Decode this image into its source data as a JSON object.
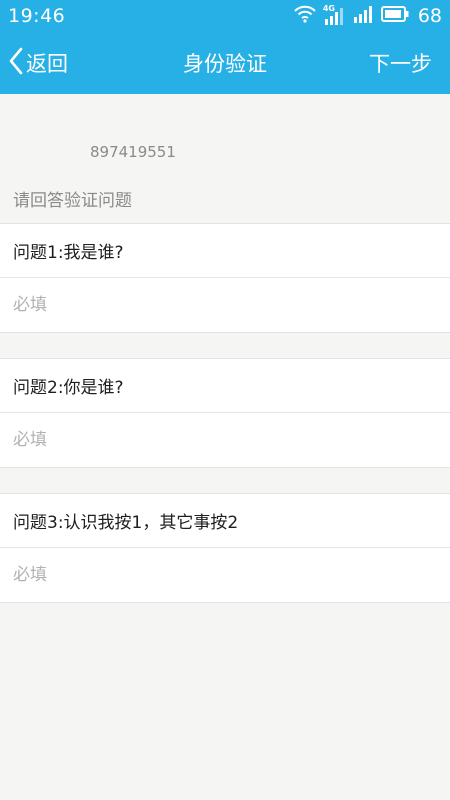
{
  "status_bar": {
    "time": "19:46",
    "network_label": "4G",
    "battery": "68",
    "icons": [
      "wifi-icon",
      "signal-4g-icon",
      "signal-icon",
      "battery-icon"
    ]
  },
  "header": {
    "back_label": "返回",
    "title": "身份验证",
    "next_label": "下一步"
  },
  "account": {
    "id": "897419551"
  },
  "prompt": "请回答验证问题",
  "questions": [
    {
      "question": "问题1:我是谁?",
      "answer": "",
      "placeholder": "必填"
    },
    {
      "question": "问题2:你是谁?",
      "answer": "",
      "placeholder": "必填"
    },
    {
      "question": "问题3:认识我按1，其它事按2",
      "answer": "",
      "placeholder": "必填"
    }
  ],
  "colors": {
    "accent": "#27b0e6",
    "background": "#f5f5f3",
    "hint_text": "#8a8a8a",
    "placeholder": "#b2b2b2"
  }
}
